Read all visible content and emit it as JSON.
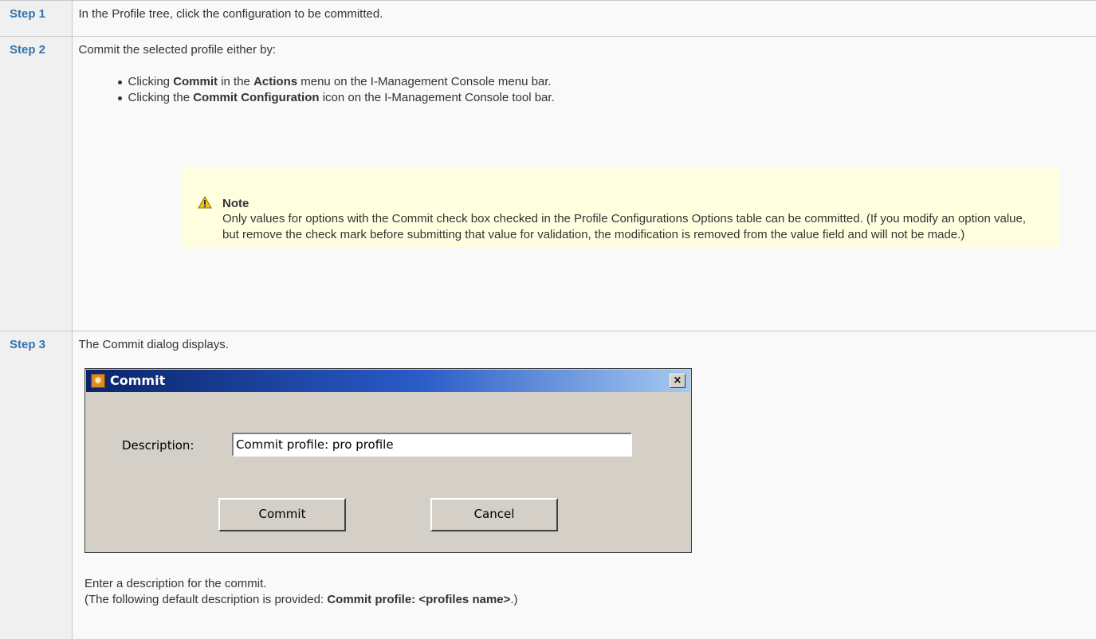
{
  "steps": [
    {
      "label": "Step 1",
      "text": "In the Profile tree, click the configuration to be committed."
    },
    {
      "label": "Step 2",
      "text": "Commit the selected profile either by:",
      "bullets": [
        {
          "p1": "Clicking ",
          "b1": "Commit",
          "p2": " in the ",
          "b2": "Actions",
          "p3": " menu on the I-Management Console menu bar."
        },
        {
          "p1": "Clicking the ",
          "b1": "Commit Configuration",
          "p2": " icon on the I-Management Console tool bar."
        }
      ],
      "note": {
        "icon": "warning-icon",
        "title": "Note",
        "text": "Only values for options with the Commit check box checked in the Profile Configurations Options table can be committed. (If you modify an option value, but remove the check mark before submitting that value for validation, the modification is removed from the value field and will not be made.)"
      }
    },
    {
      "label": "Step 3",
      "text": "The Commit dialog displays.",
      "after1": "Enter a description for the commit.",
      "after2_pre": "(The following default description is provided: ",
      "after2_bold": "Commit profile: <profiles name>",
      "after2_post": ".)"
    }
  ],
  "dialog": {
    "title": "Commit",
    "close_label": "×",
    "description_label": "Description:",
    "description_value": "Commit profile: pro profile",
    "commit_label": "Commit",
    "cancel_label": "Cancel"
  },
  "colors": {
    "step_label": "#3572b0",
    "note_background": "#ffffe0",
    "dialog_face": "#d4d0c8",
    "titlebar_start": "#0a246a"
  }
}
